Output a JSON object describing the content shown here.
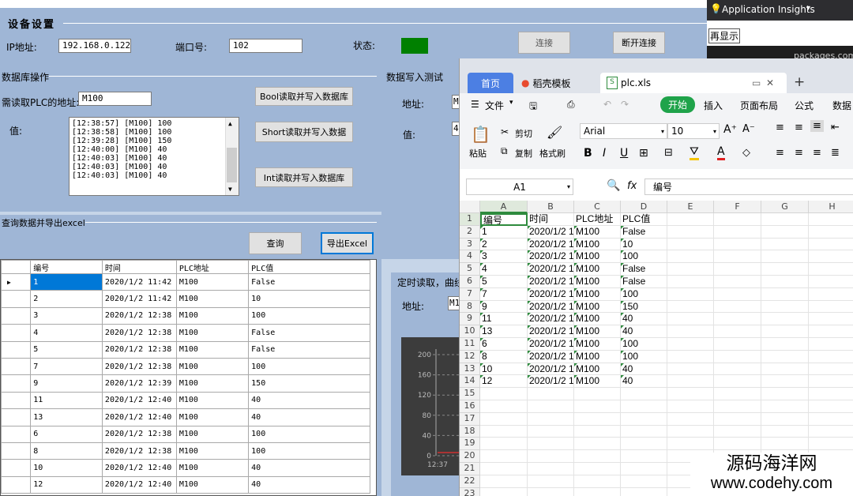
{
  "device": {
    "group_title": "设备设置",
    "ip_label": "IP地址:",
    "ip_value": "192.168.0.122",
    "port_label": "端口号:",
    "port_value": "102",
    "status_label": "状态:",
    "status_color": "#008000",
    "connect_label": "连接",
    "disconnect_label": "断开连接"
  },
  "db_ops": {
    "group_title": "数据库操作",
    "addr_label": "需读取PLC的地址:",
    "addr_value": "M100",
    "value_label": "值:",
    "log": [
      "[12:38:57] [M100] 100",
      "[12:38:58] [M100] 100",
      "[12:39:28] [M100] 150",
      "[12:40:00] [M100] 40",
      "[12:40:03] [M100] 40",
      "[12:40:03] [M100] 40",
      "[12:40:03] [M100] 40"
    ],
    "bool_btn": "Bool读取并写入数据库",
    "short_btn": "Short读取并写入数据",
    "int_btn": "Int读取并写入数据库"
  },
  "write_test": {
    "group_title": "数据写入测试",
    "addr_label": "地址:",
    "value_label": "值:",
    "addr_value": "M",
    "value_value": "4"
  },
  "timer": {
    "group_title": "定时读取，曲线",
    "addr_label": "地址:",
    "addr_value": "M1",
    "chart_ticks": [
      "200",
      "160",
      "120",
      "80",
      "40",
      "0"
    ],
    "chart_time": "12:37"
  },
  "query": {
    "group_title": "查询数据并导出excel",
    "query_btn": "查询",
    "export_btn": "导出Excel",
    "columns": [
      "编号",
      "时间",
      "PLC地址",
      "PLC值"
    ],
    "rows": [
      [
        "1",
        "2020/1/2 11:42",
        "M100",
        "False"
      ],
      [
        "2",
        "2020/1/2 11:42",
        "M100",
        "10"
      ],
      [
        "3",
        "2020/1/2 12:38",
        "M100",
        "100"
      ],
      [
        "4",
        "2020/1/2 12:38",
        "M100",
        "False"
      ],
      [
        "5",
        "2020/1/2 12:38",
        "M100",
        "False"
      ],
      [
        "7",
        "2020/1/2 12:38",
        "M100",
        "100"
      ],
      [
        "9",
        "2020/1/2 12:39",
        "M100",
        "150"
      ],
      [
        "11",
        "2020/1/2 12:40",
        "M100",
        "40"
      ],
      [
        "13",
        "2020/1/2 12:40",
        "M100",
        "40"
      ],
      [
        "6",
        "2020/1/2 12:38",
        "M100",
        "100"
      ],
      [
        "8",
        "2020/1/2 12:38",
        "M100",
        "100"
      ],
      [
        "10",
        "2020/1/2 12:40",
        "M100",
        "40"
      ],
      [
        "12",
        "2020/1/2 12:40",
        "M100",
        "40"
      ]
    ]
  },
  "insights": {
    "title": "Application Insights",
    "line2": "再显示",
    "line3": "packages.com"
  },
  "excel": {
    "tab_home": "首页",
    "tab_template": "稻壳模板",
    "tab_file": "plc.xls",
    "menu": [
      "文件",
      "开始",
      "插入",
      "页面布局",
      "公式",
      "数据"
    ],
    "paste": "粘贴",
    "cut": "剪切",
    "copy": "复制",
    "format_painter": "格式刷",
    "font_name": "Arial",
    "font_size": "10",
    "cell_ref": "A1",
    "fx": "fx",
    "formula_value": "编号",
    "col_headers": [
      "A",
      "B",
      "C",
      "D",
      "E",
      "F",
      "G",
      "H"
    ],
    "row_numbers": [
      "1",
      "2",
      "3",
      "4",
      "5",
      "6",
      "7",
      "8",
      "9",
      "10",
      "11",
      "12",
      "13",
      "14",
      "15",
      "16",
      "17",
      "18",
      "19",
      "20",
      "21",
      "22",
      "23"
    ],
    "sheet_rows": [
      [
        "编号",
        "时间",
        "PLC地址",
        "PLC值"
      ],
      [
        "1",
        "2020/1/2 1",
        "M100",
        "False"
      ],
      [
        "2",
        "2020/1/2 1",
        "M100",
        "10"
      ],
      [
        "3",
        "2020/1/2 1",
        "M100",
        "100"
      ],
      [
        "4",
        "2020/1/2 1",
        "M100",
        "False"
      ],
      [
        "5",
        "2020/1/2 1",
        "M100",
        "False"
      ],
      [
        "7",
        "2020/1/2 1",
        "M100",
        "100"
      ],
      [
        "9",
        "2020/1/2 1",
        "M100",
        "150"
      ],
      [
        "11",
        "2020/1/2 1",
        "M100",
        "40"
      ],
      [
        "13",
        "2020/1/2 1",
        "M100",
        "40"
      ],
      [
        "6",
        "2020/1/2 1",
        "M100",
        "100"
      ],
      [
        "8",
        "2020/1/2 1",
        "M100",
        "100"
      ],
      [
        "10",
        "2020/1/2 1",
        "M100",
        "40"
      ],
      [
        "12",
        "2020/1/2 1",
        "M100",
        "40"
      ]
    ]
  },
  "watermark": {
    "line1": "源码海洋网",
    "line2": "www.codehy.com"
  }
}
